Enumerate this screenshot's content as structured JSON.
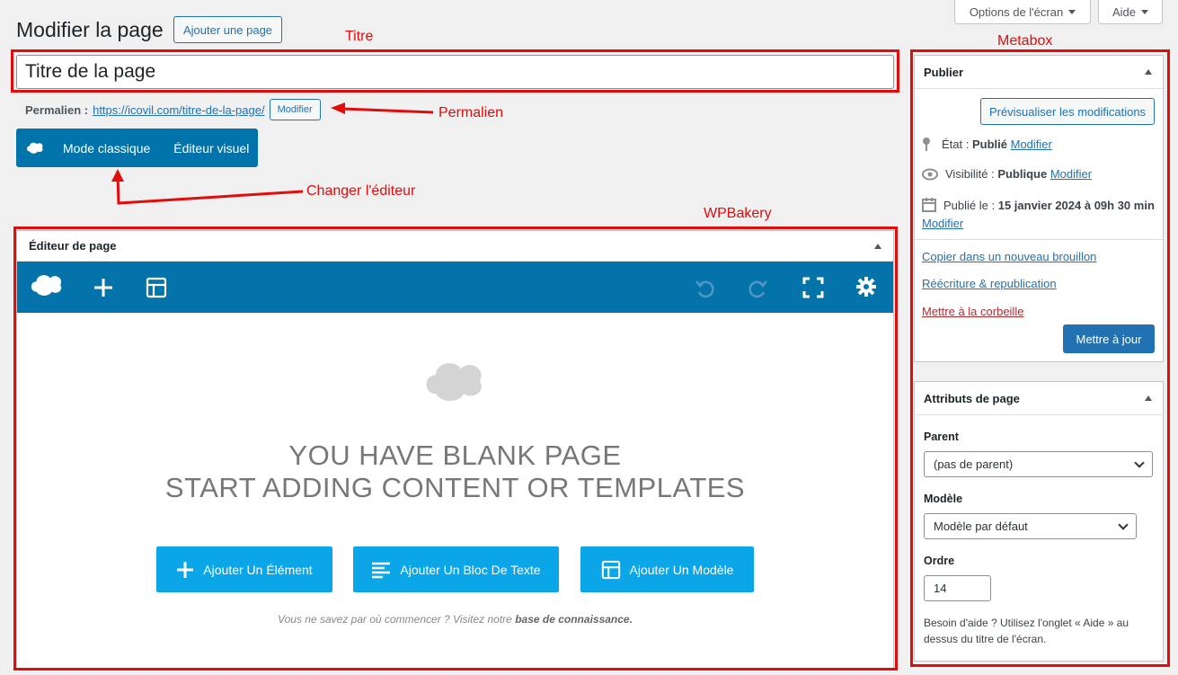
{
  "screen_options": {
    "options_label": "Options de l'écran",
    "help_label": "Aide"
  },
  "header": {
    "title": "Modifier la page",
    "add_page_label": "Ajouter une page"
  },
  "annotations": {
    "titre": "Titre",
    "metabox": "Metabox",
    "permalien": "Permalien",
    "changer_editeur": "Changer l'éditeur",
    "wpbakery": "WPBakery",
    "color": "#e10c0c"
  },
  "title_input": {
    "value": "Titre de la page"
  },
  "permalink": {
    "label": "Permalien :",
    "url": "https://icovil.com/titre-de-la-page/",
    "edit_label": "Modifier"
  },
  "mode_bar": {
    "classic_label": "Mode classique",
    "visual_label": "Éditeur visuel",
    "color": "#0073aa"
  },
  "editor": {
    "header": "Éditeur de page",
    "blank_line1": "YOU HAVE BLANK PAGE",
    "blank_line2": "START ADDING CONTENT OR TEMPLATES",
    "buttons": {
      "add_element": "Ajouter Un Élément",
      "add_text": "Ajouter Un Bloc De Texte",
      "add_template": "Ajouter Un Modèle"
    },
    "help_prefix": "Vous ne savez par où commencer ? Visitez notre",
    "help_link": "base de connaissance.",
    "toolbar_color": "#0473aa",
    "button_color": "#0aa6e8"
  },
  "publish": {
    "header": "Publier",
    "preview_label": "Prévisualiser les modifications",
    "status_prefix": "État :",
    "status_value": "Publié",
    "status_edit": "Modifier",
    "visibility_prefix": "Visibilité :",
    "visibility_value": "Publique",
    "visibility_edit": "Modifier",
    "published_prefix": "Publié le :",
    "published_value": "15 janvier 2024 à 09h 30 min",
    "published_edit": "Modifier",
    "copy_draft": "Copier dans un nouveau brouillon",
    "rewrite": "Réécriture & republication",
    "trash": "Mettre à la corbeille",
    "update_label": "Mettre à jour"
  },
  "attributes": {
    "header": "Attributs de page",
    "parent_label": "Parent",
    "parent_value": "(pas de parent)",
    "template_label": "Modèle",
    "template_value": "Modèle par défaut",
    "order_label": "Ordre",
    "order_value": "14",
    "help_text": "Besoin d'aide ? Utilisez l'onglet « Aide » au dessus du titre de l'écran."
  }
}
